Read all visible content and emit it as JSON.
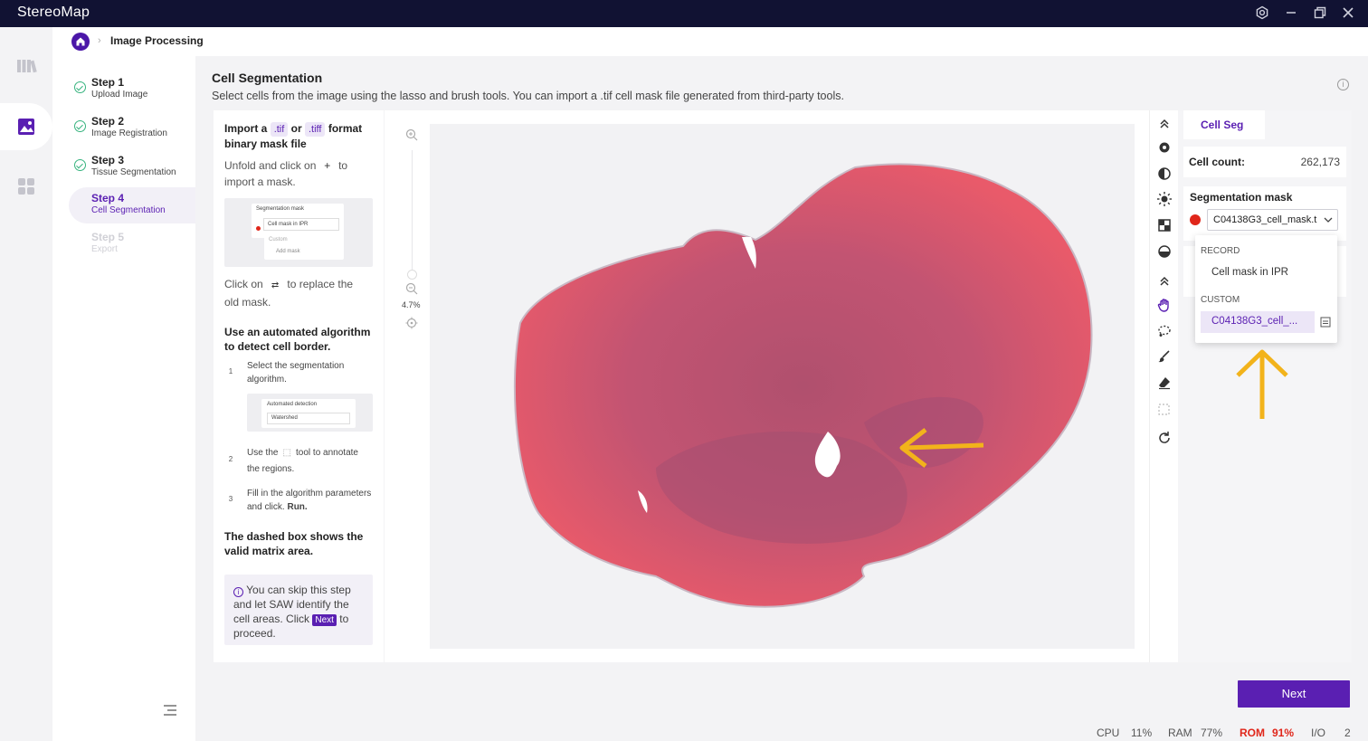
{
  "app": {
    "title": "StereoMap"
  },
  "breadcrumb": {
    "current": "Image Processing"
  },
  "steps": [
    {
      "title": "Step 1",
      "subtitle": "Upload Image",
      "state": "done"
    },
    {
      "title": "Step 2",
      "subtitle": "Image Registration",
      "state": "done"
    },
    {
      "title": "Step 3",
      "subtitle": "Tissue Segmentation",
      "state": "done"
    },
    {
      "title": "Step 4",
      "subtitle": "Cell Segmentation",
      "state": "active"
    },
    {
      "title": "Step 5",
      "subtitle": "Export",
      "state": "disabled"
    }
  ],
  "header": {
    "title": "Cell Segmentation",
    "subtitle": "Select cells from the image using the lasso and brush tools. You can import a .tif cell mask file generated from third-party tools."
  },
  "guide": {
    "import_a": "Import a",
    "tif": ".tif",
    "or": "or",
    "tiff": ".tiff",
    "format": "format",
    "binary": "binary mask file",
    "unfold_pre": "Unfold and click on",
    "unfold_post": "to",
    "unfold_post2": "import a mask.",
    "mini1_title": "Segmentation mask",
    "mini1_item": "Cell mask in IPR",
    "mini1_custom": "Custom",
    "mini1_add": "Add mask",
    "click_pre": "Click on",
    "click_post": "to replace the",
    "click_post2": "old mask.",
    "auto_title": "Use an automated algorithm to detect cell border.",
    "s1": "Select the segmentation algorithm.",
    "mini2_title": "Automated detection",
    "mini2_value": "Watershed",
    "s2_pre": "Use the",
    "s2_post": "tool to annotate",
    "s2_post2": "the regions.",
    "s3_pre": "Fill in the algorithm parameters and click.",
    "s3_bold": "Run.",
    "dashed": "The dashed box shows the valid matrix area.",
    "tip_pre": "You can skip this step and let SAW identify the cell areas. Click",
    "tip_next": "Next",
    "tip_post": "to proceed."
  },
  "zoom": {
    "level": "4.7%"
  },
  "right_panel": {
    "tab": "Cell Seg",
    "cell_count_label": "Cell count:",
    "cell_count_value": "262,173",
    "seg_mask_label": "Segmentation mask",
    "seg_mask_value": "C04138G3_cell_mask.t",
    "dropdown": {
      "record_label": "RECORD",
      "record_item": "Cell mask in IPR",
      "custom_label": "CUSTOM",
      "custom_item": "C04138G3_cell_..."
    }
  },
  "next_button": "Next",
  "status": {
    "cpu_label": "CPU",
    "cpu": "11%",
    "ram_label": "RAM",
    "ram": "77%",
    "rom_label": "ROM",
    "rom": "91%",
    "io_label": "I/O",
    "io": "2"
  },
  "colors": {
    "accent": "#5a1fb2",
    "titlebar": "#111233",
    "rom_alert": "#e0261a",
    "arrow": "#f2b31b"
  }
}
